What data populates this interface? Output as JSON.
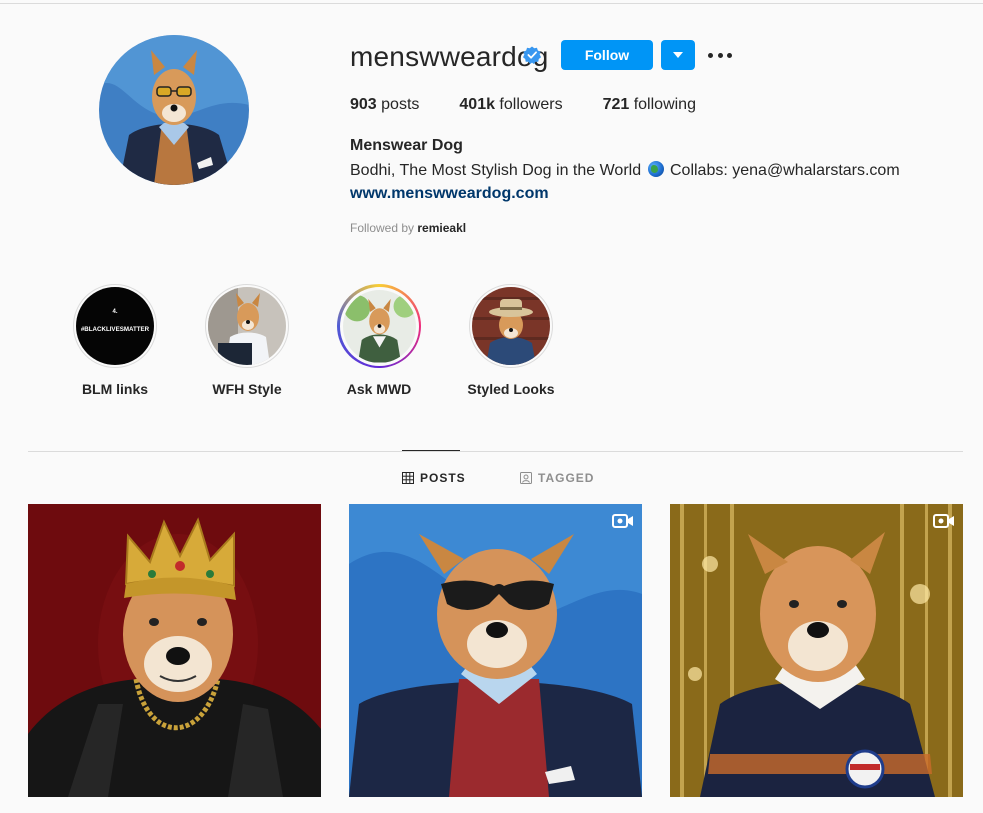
{
  "profile": {
    "username": "menswweardog",
    "verified": true,
    "follow_label": "Follow",
    "stats": [
      {
        "count": "903",
        "label": " posts"
      },
      {
        "count": "401k",
        "label": " followers"
      },
      {
        "count": "721",
        "label": " following"
      }
    ],
    "full_name": "Menswear Dog",
    "bio_before_globe": "Bodhi, The Most Stylish Dog in the World ",
    "bio_after_globe": " Collabs: yena@whalarstars.com",
    "website": "www.menswweardog.com",
    "followed_by_prefix": "Followed by ",
    "followed_by_user": "remieakl"
  },
  "highlights": [
    {
      "label": "BLM links",
      "cover_text_top": "4.",
      "cover_text": "#BLACKLIVESMATTER"
    },
    {
      "label": "WFH Style"
    },
    {
      "label": "Ask MWD"
    },
    {
      "label": "Styled Looks"
    }
  ],
  "tabs": [
    {
      "label": "POSTS",
      "icon": "grid-icon",
      "active": true
    },
    {
      "label": "TAGGED",
      "icon": "tagged-icon",
      "active": false
    }
  ],
  "posts": [
    {
      "icon": null
    },
    {
      "icon": "video-icon"
    },
    {
      "icon": "video-icon"
    }
  ],
  "colors": {
    "accent": "#0095f6",
    "link": "#00376b",
    "muted": "#8e8e8e",
    "background": "#fafafa"
  }
}
